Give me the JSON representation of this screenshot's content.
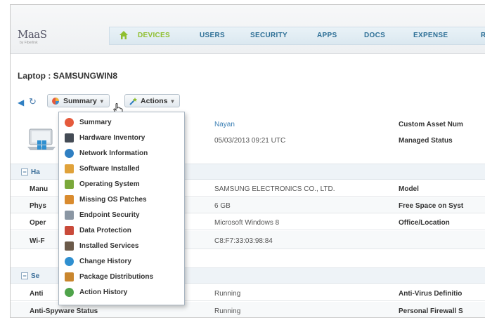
{
  "header": {
    "logo": "MaaS",
    "logo_sub": "by Fiberlink",
    "nav": [
      "DEVICES",
      "USERS",
      "SECURITY",
      "APPS",
      "DOCS",
      "EXPENSE",
      "R"
    ]
  },
  "page": {
    "title": "Laptop : SAMSUNGWIN8"
  },
  "toolbar": {
    "summary_label": "Summary",
    "actions_label": "Actions"
  },
  "menu": {
    "items": [
      {
        "label": "Summary",
        "icon": "pie-chart-icon",
        "color": "#e55a3c"
      },
      {
        "label": "Hardware Inventory",
        "icon": "monitor-icon",
        "color": "#444b55"
      },
      {
        "label": "Network Information",
        "icon": "globe-icon",
        "color": "#2f7fc2"
      },
      {
        "label": "Software Installed",
        "icon": "package-icon",
        "color": "#e0a23a"
      },
      {
        "label": "Operating System",
        "icon": "os-icon",
        "color": "#7aa83a"
      },
      {
        "label": "Missing OS Patches",
        "icon": "puzzle-icon",
        "color": "#d98b2e"
      },
      {
        "label": "Endpoint Security",
        "icon": "lock-icon",
        "color": "#8a96a3"
      },
      {
        "label": "Data Protection",
        "icon": "shield-icon",
        "color": "#c94a3a"
      },
      {
        "label": "Installed Services",
        "icon": "briefcase-icon",
        "color": "#6b5a4a"
      },
      {
        "label": "Change History",
        "icon": "history-icon",
        "color": "#2f8fd0"
      },
      {
        "label": "Package Distributions",
        "icon": "package-dist-icon",
        "color": "#c9862e"
      },
      {
        "label": "Action History",
        "icon": "action-history-icon",
        "color": "#4fa34a"
      }
    ]
  },
  "summary": {
    "owner": "Nayan",
    "last_seen": "05/03/2013 09:21 UTC",
    "right_labels": [
      "Custom Asset Num",
      "Managed Status"
    ]
  },
  "sections": [
    {
      "title": "Ha"
    },
    {
      "title": "Se"
    }
  ],
  "hardware_rows": [
    {
      "label": "Manu",
      "value": "SAMSUNG ELECTRONICS CO., LTD.",
      "right": "Model"
    },
    {
      "label": "Phys",
      "value": "6 GB",
      "right": "Free Space on Syst"
    },
    {
      "label": "Oper",
      "value": "Microsoft Windows 8",
      "right": "Office/Location"
    },
    {
      "label": "Wi-F",
      "value": "C8:F7:33:03:98:84",
      "right": ""
    }
  ],
  "security_rows": [
    {
      "label": "Anti",
      "value": "Running",
      "right": "Anti-Virus Definitio"
    },
    {
      "label": "Anti-Spyware Status",
      "value": "Running",
      "right": "Personal Firewall S"
    }
  ]
}
